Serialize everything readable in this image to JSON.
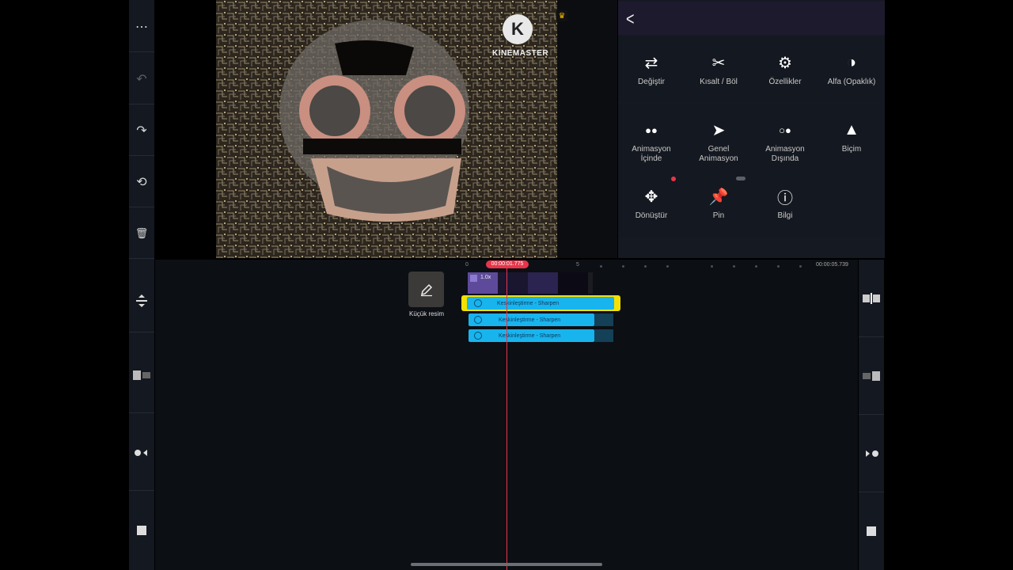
{
  "left_toolbar": {
    "more_label": "⋯",
    "undo_label": "↶",
    "redo_label": "↷",
    "rewind_label": "⟲",
    "delete_label": "🗑"
  },
  "preview": {
    "watermark": "KINEMASTER",
    "watermark_logo": "K",
    "premium_icon": "♛"
  },
  "panel": {
    "back_label": "<",
    "tiles": [
      {
        "icon": "⇄",
        "label": "Değiştir"
      },
      {
        "icon": "✂",
        "label": "Kısalt / Böl"
      },
      {
        "icon": "⚙",
        "label": "Özellikler"
      },
      {
        "icon": "◑",
        "label": "Alfa (Opaklık)"
      },
      {
        "icon": "●●",
        "label_line1": "Animasyon",
        "label_line2": "İçinde"
      },
      {
        "icon": "➤",
        "label_line1": "Genel",
        "label_line2": "Animasyon"
      },
      {
        "icon": "○●",
        "label_line1": "Animasyon",
        "label_line2": "Dışında"
      },
      {
        "icon": "▲",
        "label": "Biçim"
      },
      {
        "icon": "✥",
        "label": "Dönüştür"
      },
      {
        "icon": "📌",
        "label": "Pin"
      },
      {
        "icon": "ⓘ",
        "label": "Bilgi"
      }
    ]
  },
  "timeline": {
    "playhead_time": "00:00:01.775",
    "total_time": "00:00:05.739",
    "ruler_start": "0",
    "ruler_mark": "5",
    "thumbnail_label": "Küçük resim",
    "clip_speed": "1.0x",
    "effect_clips": [
      {
        "label": "Keskinleştirme - Sharpen",
        "selected": true
      },
      {
        "label": "Keskinleştirme - Sharpen",
        "selected": false
      },
      {
        "label": "Keskinleştirme - Sharpen",
        "selected": false
      }
    ]
  },
  "colors": {
    "accent": "#e8354a",
    "effect_clip": "#18b4ee",
    "selection": "#f4e100"
  }
}
